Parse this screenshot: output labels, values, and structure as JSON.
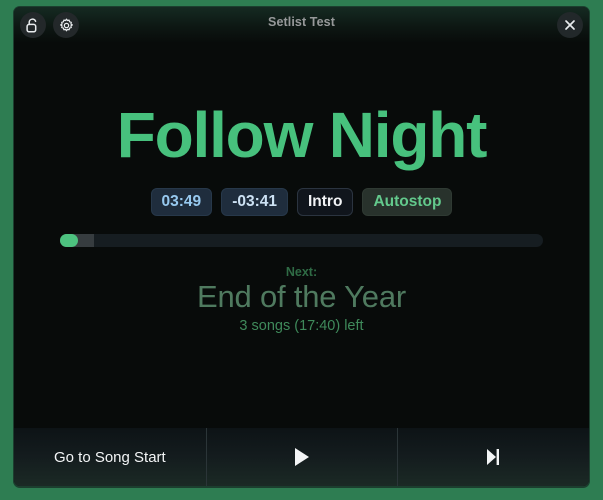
{
  "window": {
    "title": "Setlist Test",
    "lock_icon": "unlocked-padlock-icon",
    "settings_icon": "gear-icon",
    "close_icon": "close-icon",
    "frame_color": "#2e7d52",
    "background_color": "#080b0a"
  },
  "now_playing": {
    "song_title": "Follow Night",
    "title_color": "#47c17d",
    "badges": [
      {
        "label": "03:49",
        "name": "elapsed-time-badge",
        "color": "#97c9ef",
        "bg": "#1f2d3d"
      },
      {
        "label": "-03:41",
        "name": "remaining-time-badge",
        "color": "#cde2f4",
        "bg": "#1f2d3d"
      },
      {
        "label": "Intro",
        "name": "marker-badge",
        "color": "#f2f4f6",
        "bg": "#10151c"
      },
      {
        "label": "Autostop",
        "name": "autostop-badge",
        "color": "#63c98c",
        "bg": "#28322c"
      }
    ],
    "progress": {
      "percent": 3.7,
      "secondary_percent": 7.0,
      "fill_color": "#4dc27f",
      "track_color": "#161d21"
    }
  },
  "next_up": {
    "label": "Next:",
    "title": "End of the Year",
    "meta": "3 songs (17:40) left",
    "label_color": "#2f6b45",
    "title_color": "#4f7a5f",
    "meta_color": "#3f8a5b"
  },
  "toolbar": {
    "go_to_song_start": "Go to Song Start",
    "play_icon": "play-icon",
    "next_track_icon": "skip-next-icon"
  }
}
